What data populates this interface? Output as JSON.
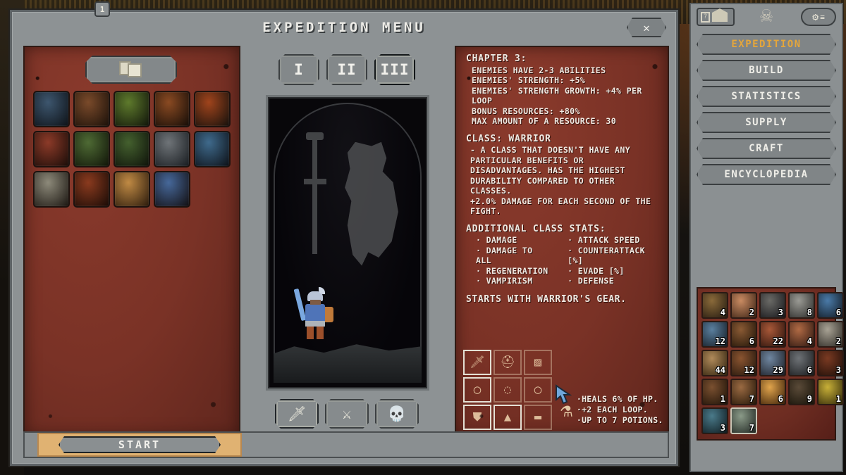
{
  "window": {
    "title": "EXPEDITION MENU",
    "close_label": "✕"
  },
  "hud": {
    "loop_badge": "1"
  },
  "left_panel": {
    "deck_button_icon": "cards-icon",
    "cards": [
      {
        "name": "lich-card",
        "c1": "#3d566e",
        "c2": "#0d1116"
      },
      {
        "name": "battlefield-card",
        "c1": "#7a4a2a",
        "c2": "#1a1009"
      },
      {
        "name": "grove-card",
        "c1": "#5e7a2c",
        "c2": "#10140a"
      },
      {
        "name": "spider-cocoon-card",
        "c1": "#8a4a22",
        "c2": "#140c07"
      },
      {
        "name": "blood-grove-card",
        "c1": "#a0441c",
        "c2": "#14100c"
      },
      {
        "name": "grave-card",
        "c1": "#8c3a28",
        "c2": "#190c08"
      },
      {
        "name": "meadow-card",
        "c1": "#4e6a34",
        "c2": "#101408"
      },
      {
        "name": "forest-card",
        "c1": "#44602e",
        "c2": "#0e120a"
      },
      {
        "name": "outpost-card",
        "c1": "#6f7478",
        "c2": "#171b1f"
      },
      {
        "name": "ice-cave-card",
        "c1": "#3f6a8c",
        "c2": "#0c1016"
      },
      {
        "name": "watchtower-card",
        "c1": "#8d8a7a",
        "c2": "#1a1510"
      },
      {
        "name": "ridge-card",
        "c1": "#8a3a1e",
        "c2": "#190b06"
      },
      {
        "name": "desert-card",
        "c1": "#c08a44",
        "c2": "#2a1a0c"
      },
      {
        "name": "temporal-beacon-card",
        "c1": "#46689a",
        "c2": "#120e10"
      }
    ]
  },
  "center": {
    "chapters": [
      {
        "label": "I",
        "selected": false
      },
      {
        "label": "II",
        "selected": false
      },
      {
        "label": "III",
        "selected": true
      }
    ],
    "classes": [
      {
        "name": "warrior-class-button",
        "glyph": "🗡",
        "selected": true
      },
      {
        "name": "rogue-class-button",
        "glyph": "⚔",
        "selected": false
      },
      {
        "name": "necromancer-class-button",
        "glyph": "💀",
        "selected": false
      }
    ]
  },
  "info": {
    "chapter_heading": "CHAPTER 3:",
    "chapter_lines": [
      "ENEMIES HAVE 2-3 ABILITIES",
      "ENEMIES' STRENGTH: +5%",
      "ENEMIES' STRENGTH GROWTH: +4% PER LOOP",
      "BONUS RESOURCES: +80%",
      "MAX AMOUNT OF A RESOURCE: 30"
    ],
    "class_heading": "CLASS: WARRIOR",
    "class_lines": [
      "- A CLASS THAT DOESN'T HAVE ANY PARTICULAR BENEFITS OR DISADVANTAGES. HAS THE HIGHEST DURABILITY COMPARED TO OTHER CLASSES.",
      "+2.0% DAMAGE FOR EACH SECOND OF THE FIGHT."
    ],
    "stats_heading": "ADDITIONAL CLASS STATS:",
    "stats_left": [
      "DAMAGE",
      "DAMAGE TO ALL",
      "REGENERATION",
      "VAMPIRISM"
    ],
    "stats_right": [
      "ATTACK SPEED",
      "COUNTERATTACK [%]",
      "EVADE [%]",
      "DEFENSE"
    ],
    "starts_with": "STARTS WITH WARRIOR'S GEAR."
  },
  "equipment": {
    "slots": [
      {
        "name": "weapon-slot",
        "glyph": "🗡",
        "active": true
      },
      {
        "name": "helmet-slot",
        "glyph": "⛑",
        "active": false
      },
      {
        "name": "cape-slot",
        "glyph": "▨",
        "active": false
      },
      {
        "name": "ring-left-slot",
        "glyph": "◯",
        "active": true
      },
      {
        "name": "amulet-slot",
        "glyph": "◌",
        "active": false
      },
      {
        "name": "ring-right-slot",
        "glyph": "◯",
        "active": false
      },
      {
        "name": "shield-slot",
        "glyph": "⛊",
        "active": true
      },
      {
        "name": "armor-slot",
        "glyph": "▲",
        "active": true
      },
      {
        "name": "boots-slot",
        "glyph": "▬",
        "active": false
      }
    ]
  },
  "potion": {
    "icon": "potion-icon",
    "lines": [
      "·HEALS 6% OF HP.",
      "·+2 EACH LOOP.",
      "·UP TO 7 POTIONS."
    ]
  },
  "start": {
    "label": "START"
  },
  "sidebar": {
    "help_icon": "question-icon",
    "home_icon": "house-icon",
    "skull_icon": "skull-banner-icon",
    "settings_icon": "gear-icon",
    "nav": [
      {
        "label": "EXPEDITION",
        "active": true
      },
      {
        "label": "BUILD",
        "active": false
      },
      {
        "label": "STATISTICS",
        "active": false
      },
      {
        "label": "SUPPLY",
        "active": false
      },
      {
        "label": "CRAFT",
        "active": false
      },
      {
        "label": "ENCYCLOPEDIA",
        "active": false
      }
    ],
    "accent_color": "#e5a63b"
  },
  "inventory": {
    "items": [
      {
        "name": "branch-resource",
        "count": "4",
        "c1": "#8a6a3a",
        "c2": "#241a10",
        "hl": false
      },
      {
        "name": "wing-resource",
        "count": "2",
        "c1": "#c98b62",
        "c2": "#3a2214",
        "hl": false
      },
      {
        "name": "pebble-resource",
        "count": "3",
        "c1": "#6a6a66",
        "c2": "#16161a",
        "hl": false
      },
      {
        "name": "stone-resource",
        "count": "8",
        "c1": "#9a9a94",
        "c2": "#2a2a28",
        "hl": false
      },
      {
        "name": "crystal-resource",
        "count": "6",
        "c1": "#4a7aa8",
        "c2": "#101820",
        "hl": false
      },
      {
        "name": "orb-resource",
        "count": "12",
        "c1": "#5a7f9e",
        "c2": "#141c24",
        "hl": false
      },
      {
        "name": "claw-resource",
        "count": "6",
        "c1": "#8a5a34",
        "c2": "#201408",
        "hl": false
      },
      {
        "name": "flesh-resource",
        "count": "22",
        "c1": "#a85838",
        "c2": "#2a120c",
        "hl": false
      },
      {
        "name": "brain-resource",
        "count": "4",
        "c1": "#b06a44",
        "c2": "#2c1610",
        "hl": false
      },
      {
        "name": "skull-resource",
        "count": "2",
        "c1": "#a8a294",
        "c2": "#2a2722",
        "hl": false
      },
      {
        "name": "book-resource",
        "count": "44",
        "c1": "#b08a5a",
        "c2": "#30220e",
        "hl": false
      },
      {
        "name": "metal-resource",
        "count": "12",
        "c1": "#8a5430",
        "c2": "#22160c",
        "hl": false
      },
      {
        "name": "sphere-resource",
        "count": "29",
        "c1": "#6f86a0",
        "c2": "#1a1c22",
        "hl": false
      },
      {
        "name": "scrap-resource",
        "count": "6",
        "c1": "#6e7276",
        "c2": "#181a1c",
        "hl": false
      },
      {
        "name": "spider-resource",
        "count": "3",
        "c1": "#7a3a22",
        "c2": "#1e0e08",
        "hl": false
      },
      {
        "name": "wood-resource",
        "count": "1",
        "c1": "#7a5030",
        "c2": "#1e1208",
        "hl": false
      },
      {
        "name": "bone-resource",
        "count": "7",
        "c1": "#9a6a42",
        "c2": "#241608",
        "hl": false
      },
      {
        "name": "ember-resource",
        "count": "6",
        "c1": "#e0a44c",
        "c2": "#3c2008",
        "hl": false
      },
      {
        "name": "ore-resource",
        "count": "9",
        "c1": "#5a4a38",
        "c2": "#161208",
        "hl": false
      },
      {
        "name": "amber-resource",
        "count": "1",
        "c1": "#c8b038",
        "c2": "#2e2608",
        "hl": false
      },
      {
        "name": "shell-resource",
        "count": "3",
        "c1": "#4a7a8a",
        "c2": "#0e1a1e",
        "hl": false
      },
      {
        "name": "relic-resource",
        "count": "7",
        "c1": "#8a9a88",
        "c2": "#1e2420",
        "hl": true
      }
    ]
  }
}
